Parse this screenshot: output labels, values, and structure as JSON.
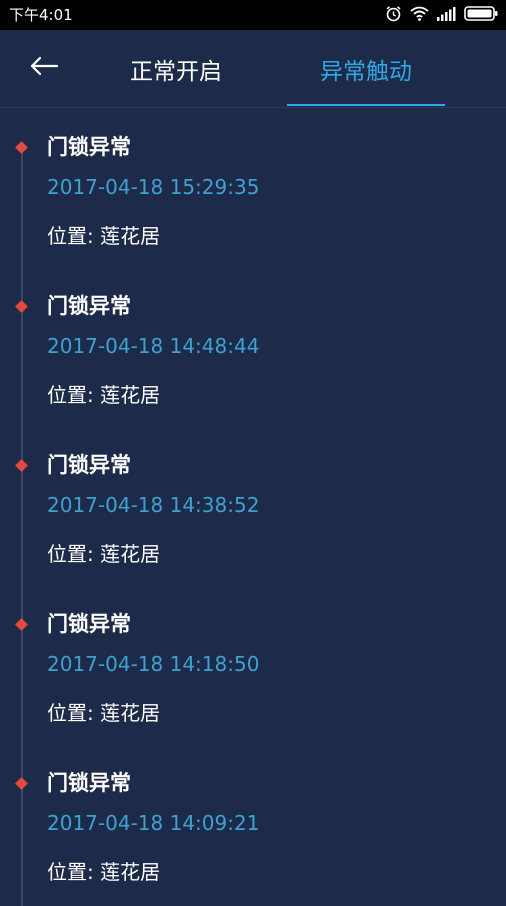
{
  "status_bar": {
    "time": "下午4:01",
    "icons": [
      "alarm-icon",
      "wifi-icon",
      "signal-icon",
      "battery-icon"
    ]
  },
  "header": {
    "back_icon": "back-arrow-icon",
    "tabs": [
      {
        "label": "正常开启",
        "active": false
      },
      {
        "label": "异常触动",
        "active": true
      }
    ]
  },
  "entries": [
    {
      "title": "门锁异常",
      "time": "2017-04-18 15:29:35",
      "location": "位置: 莲花居"
    },
    {
      "title": "门锁异常",
      "time": "2017-04-18 14:48:44",
      "location": "位置: 莲花居"
    },
    {
      "title": "门锁异常",
      "time": "2017-04-18 14:38:52",
      "location": "位置: 莲花居"
    },
    {
      "title": "门锁异常",
      "time": "2017-04-18 14:18:50",
      "location": "位置: 莲花居"
    },
    {
      "title": "门锁异常",
      "time": "2017-04-18 14:09:21",
      "location": "位置: 莲花居"
    }
  ],
  "colors": {
    "background": "#1e2a4a",
    "accent": "#2fa8e6",
    "time_text": "#3ba3d0",
    "dot": "#e8483c"
  }
}
